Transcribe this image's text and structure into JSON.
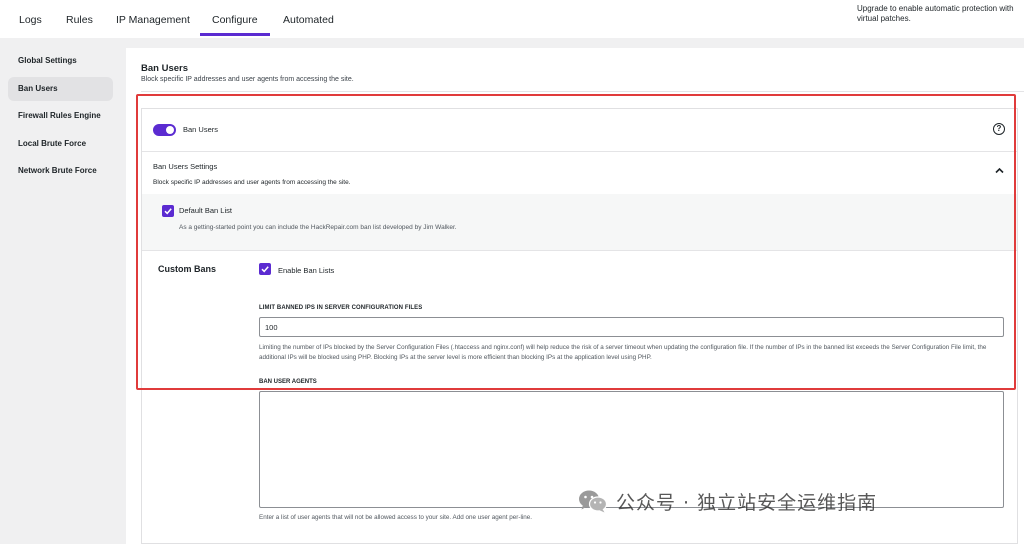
{
  "nav": {
    "tabs": [
      {
        "label": "Logs"
      },
      {
        "label": "Rules"
      },
      {
        "label": "IP Management"
      },
      {
        "label": "Configure",
        "active": true
      },
      {
        "label": "Automated"
      }
    ],
    "upgrade_line1": "Upgrade to enable automatic protection with",
    "upgrade_line2": "virtual patches."
  },
  "sidebar": {
    "items": [
      {
        "label": "Global Settings"
      },
      {
        "label": "Ban Users",
        "active": true
      },
      {
        "label": "Firewall Rules Engine"
      },
      {
        "label": "Local Brute Force"
      },
      {
        "label": "Network Brute Force"
      }
    ]
  },
  "page": {
    "title": "Ban Users",
    "description": "Block specific IP addresses and user agents from accessing the site."
  },
  "card": {
    "toggle_label": "Ban Users",
    "toggle_on": true,
    "help_icon": "question-circle-icon",
    "settings_title": "Ban Users Settings",
    "settings_desc": "Block specific IP addresses and user agents from accessing the site.",
    "default_ban": {
      "label": "Default Ban List",
      "checked": true,
      "description": "As a getting-started point you can include the HackRepair.com ban list developed by Jim Walker."
    },
    "custom_bans": {
      "title": "Custom Bans",
      "enable_label": "Enable Ban Lists",
      "enable_checked": true,
      "limit_label": "LIMIT BANNED IPS IN SERVER CONFIGURATION FILES",
      "limit_value": "100",
      "limit_help": "Limiting the number of IPs blocked by the Server Configuration Files (.htaccess and nginx.conf) will help reduce the risk of a server timeout when updating the configuration file. If the number of IPs in the banned list exceeds the Server Configuration File limit, the additional IPs will be blocked using PHP. Blocking IPs at the server level is more efficient than blocking IPs at the application level using PHP.",
      "agents_label": "BAN USER AGENTS",
      "agents_value": "",
      "agents_help": "Enter a list of user agents that will not be allowed access to your site. Add one user agent per-line."
    }
  },
  "watermark": {
    "text": "公众号 · 独立站安全运维指南"
  },
  "colors": {
    "accent": "#5b2bd1",
    "highlight": "#e03b3b"
  }
}
